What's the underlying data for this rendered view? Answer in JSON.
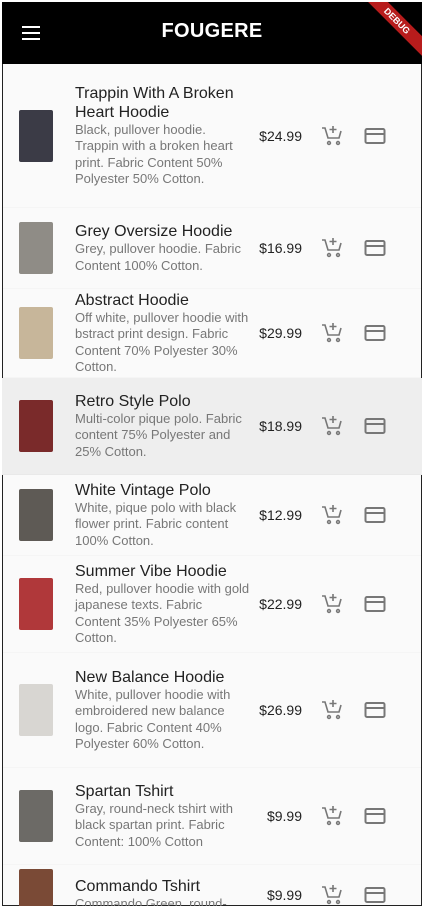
{
  "app": {
    "title": "FOUGERE",
    "debug_label": "DEBUG"
  },
  "products": [
    {
      "name": "Trappin With A Broken Heart Hoodie",
      "description": "Black, pullover hoodie. Trappin with a broken heart print. Fabric Content 50% Polyester 50% Cotton.",
      "price": "$24.99",
      "thumb_color": "#3b3b46",
      "selected": false
    },
    {
      "name": "Grey Oversize Hoodie",
      "description": "Grey, pullover hoodie. Fabric Content 100% Cotton.",
      "price": "$16.99",
      "thumb_color": "#8f8c86",
      "selected": false
    },
    {
      "name": "Abstract Hoodie",
      "description": "Off white, pullover hoodie with bstract print design. Fabric Content 70% Polyester 30% Cotton.",
      "price": "$29.99",
      "thumb_color": "#c7b69a",
      "selected": false
    },
    {
      "name": "Retro Style Polo",
      "description": "Multi-color pique polo. Fabric content 75% Polyester and 25% Cotton.",
      "price": "$18.99",
      "thumb_color": "#7a2a2a",
      "selected": true
    },
    {
      "name": "White Vintage Polo",
      "description": "White, pique polo with black flower print. Fabric content 100% Cotton.",
      "price": "$12.99",
      "thumb_color": "#5e5a55",
      "selected": false
    },
    {
      "name": "Summer Vibe Hoodie",
      "description": "Red, pullover hoodie with gold japanese texts. Fabric Content 35% Polyester 65% Cotton.",
      "price": "$22.99",
      "thumb_color": "#b0383a",
      "selected": false
    },
    {
      "name": "New Balance Hoodie",
      "description": "White, pullover hoodie with embroidered new balance logo. Fabric Content 40% Polyester 60% Cotton.",
      "price": "$26.99",
      "thumb_color": "#d8d6d2",
      "selected": false
    },
    {
      "name": "Spartan Tshirt",
      "description": "Gray, round-neck tshirt with black spartan print. Fabric Content: 100% Cotton",
      "price": "$9.99",
      "thumb_color": "#6c6a66",
      "selected": false
    },
    {
      "name": "Commando Tshirt",
      "description": "Commando Green, round-",
      "price": "$9.99",
      "thumb_color": "#7a4a36",
      "selected": false
    }
  ]
}
